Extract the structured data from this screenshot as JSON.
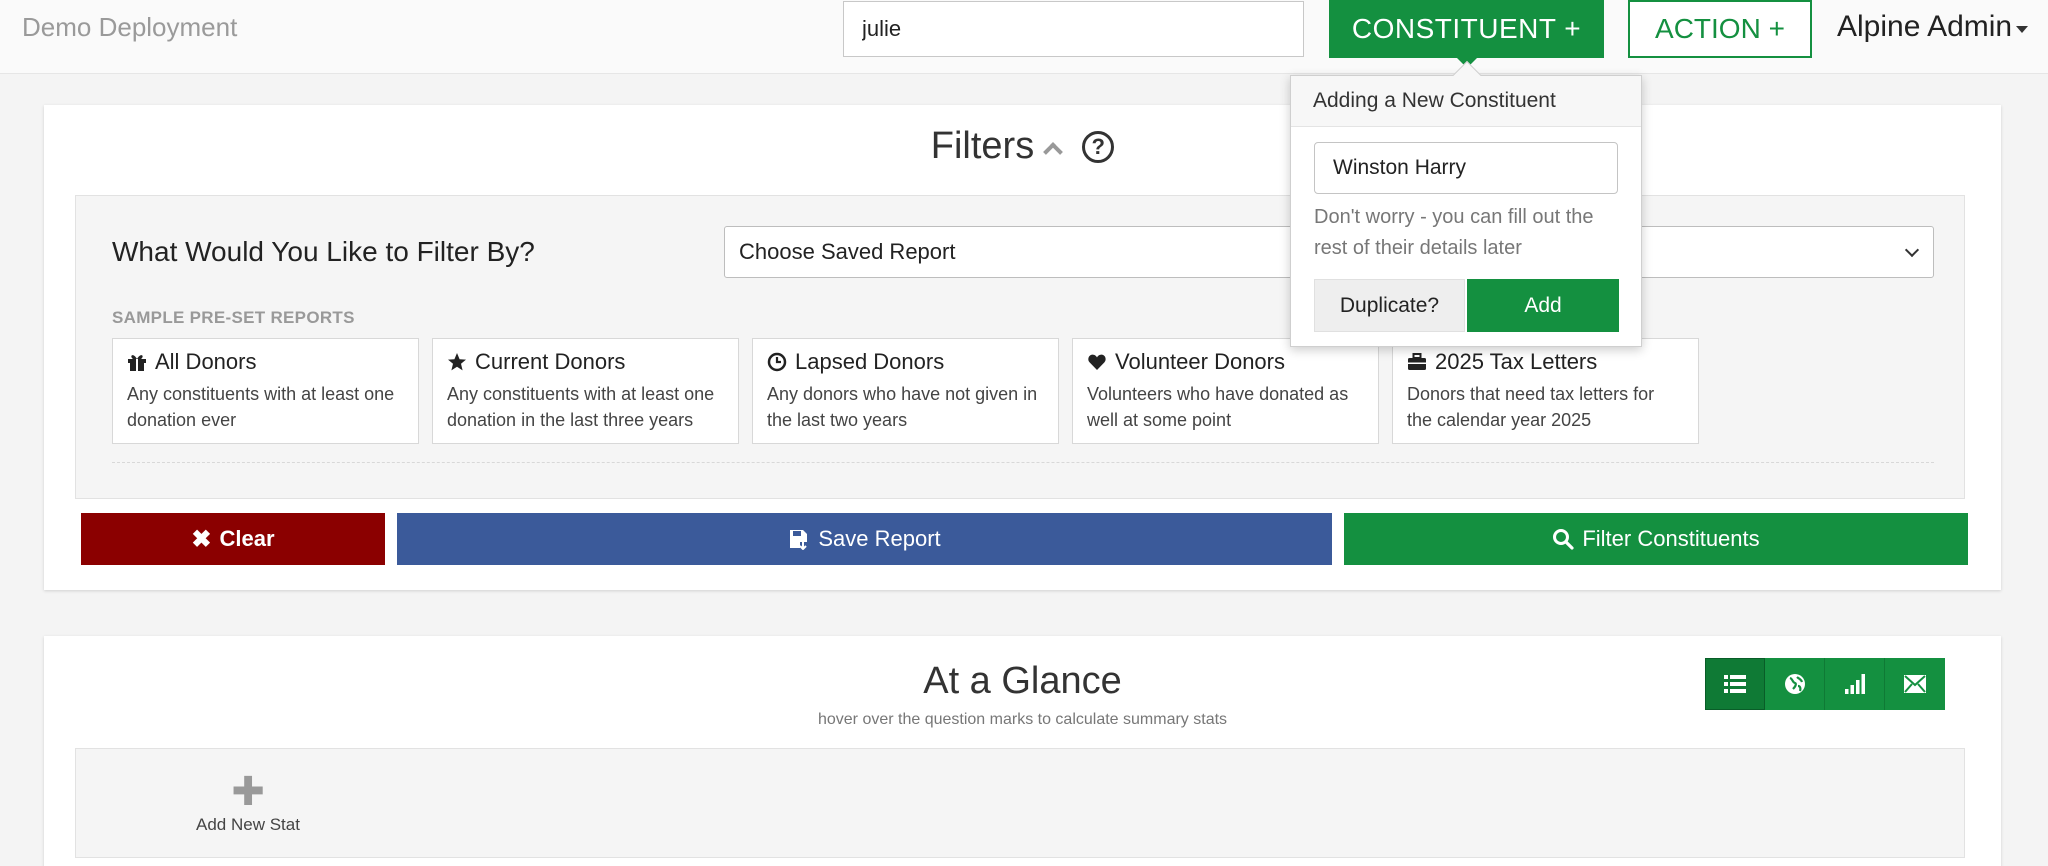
{
  "header": {
    "brand": "Demo Deployment",
    "search_value": "julie",
    "constituent_button": "CONSTITUENT +",
    "action_button": "ACTION +",
    "user_menu": "Alpine Admin"
  },
  "popover": {
    "title": "Adding a New Constituent",
    "name_value": "Winston Harry",
    "note": "Don't worry - you can fill out the rest of their details later",
    "duplicate_label": "Duplicate?",
    "add_label": "Add"
  },
  "filters": {
    "title": "Filters",
    "question": "What Would You Like to Filter By?",
    "select_value": "Choose Saved Report",
    "sample_label": "SAMPLE PRE-SET REPORTS",
    "reports": [
      {
        "title": "All Donors",
        "desc": "Any constituents with at least one donation ever",
        "icon": "gift-icon"
      },
      {
        "title": "Current Donors",
        "desc": "Any constituents with at least one donation in the last three years",
        "icon": "star-icon"
      },
      {
        "title": "Lapsed Donors",
        "desc": "Any donors who have not given in the last two years",
        "icon": "clock-icon"
      },
      {
        "title": "Volunteer Donors",
        "desc": "Volunteers who have donated as well at some point",
        "icon": "heart-icon"
      },
      {
        "title": "2025 Tax Letters",
        "desc": "Donors that need tax letters for the calendar year 2025",
        "icon": "briefcase-icon"
      }
    ],
    "clear_label": "Clear",
    "save_label": "Save Report",
    "filter_label": "Filter Constituents"
  },
  "glance": {
    "title": "At a Glance",
    "subtitle": "hover over the question marks to calculate summary stats",
    "views": [
      "list-icon",
      "globe-icon",
      "bar-chart-icon",
      "envelope-icon"
    ],
    "add_stat_label": "Add New Stat"
  },
  "colors": {
    "primary_green": "#149040",
    "clear_red": "#8b0000",
    "save_blue": "#3b5a9a"
  }
}
